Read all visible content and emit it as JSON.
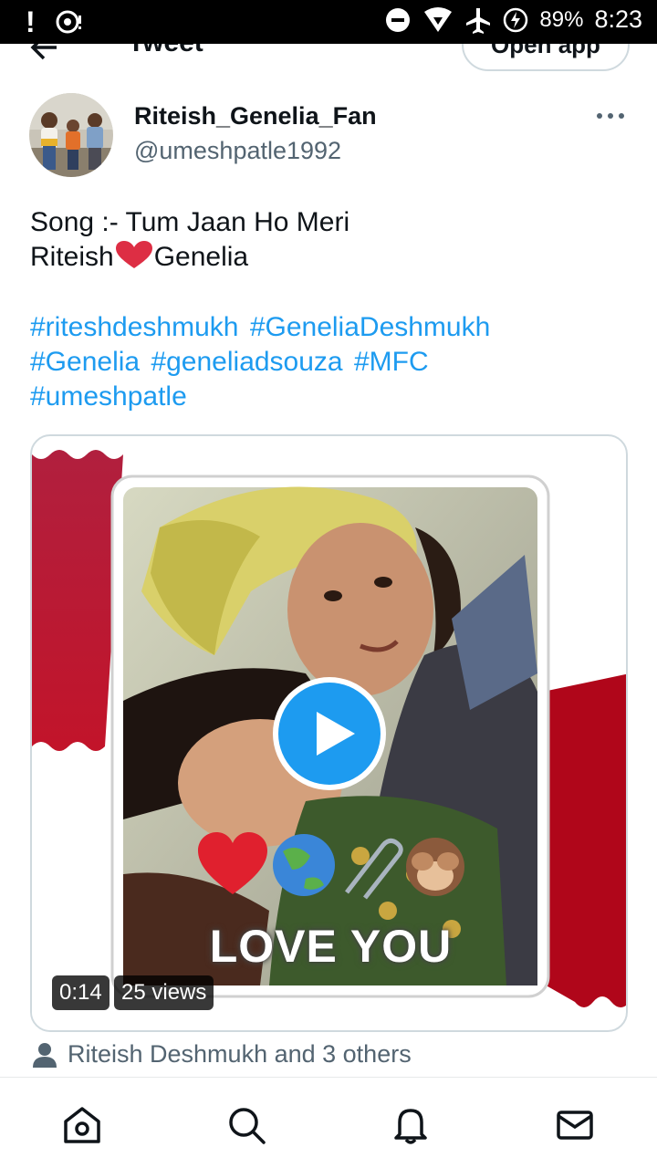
{
  "status_bar": {
    "alert": "!",
    "battery": "89%",
    "time": "8:23",
    "icons": [
      "alert-icon",
      "media-icon",
      "dnd-icon",
      "wifi-icon",
      "airplane-icon",
      "battery-charging-icon"
    ]
  },
  "header": {
    "title": "Tweet",
    "open_app": "Open app"
  },
  "author": {
    "name": "Riteish_Genelia_Fan",
    "handle": "@umeshpatle1992"
  },
  "tweet": {
    "line1": "Song :- Tum Jaan Ho Meri",
    "line2_a": "Riteish",
    "line2_b": "Genelia",
    "hashtags": [
      "#riteshdeshmukh",
      "#GeneliaDeshmukh",
      "#Genelia",
      "#geneliadsouza",
      "#MFC",
      "#umeshpatle"
    ]
  },
  "media": {
    "overlay_text": "LOVE YOU",
    "duration": "0:14",
    "views": "25 views"
  },
  "likes": {
    "text": "Riteish Deshmukh and 3 others"
  },
  "colors": {
    "link": "#1d9bf0",
    "secondary_text": "#536471",
    "border": "#cfd9de"
  }
}
